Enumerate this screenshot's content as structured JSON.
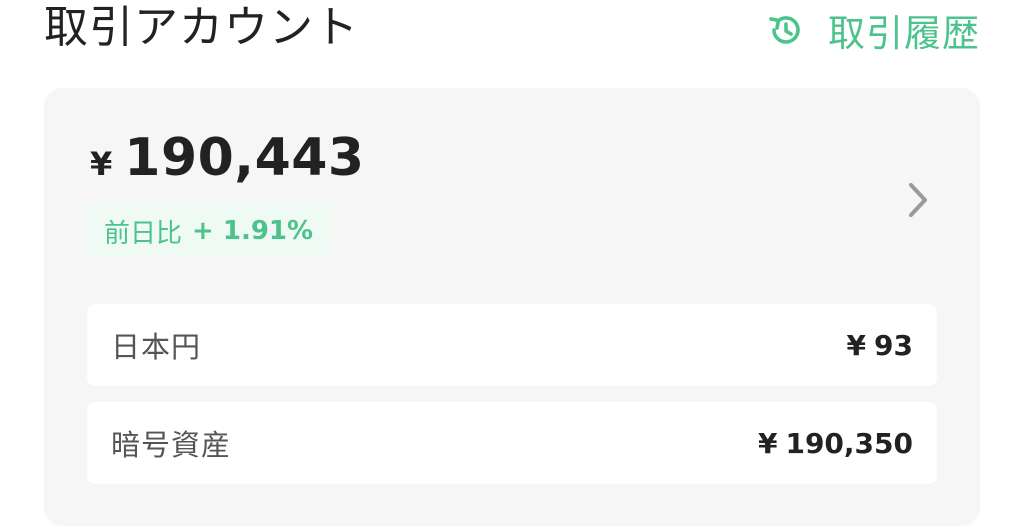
{
  "header": {
    "title": "取引アカウント",
    "history_link": {
      "label": "取引履歴",
      "icon": "history-icon"
    }
  },
  "account": {
    "currency_symbol": "¥",
    "total": "190,443",
    "change_label": "前日比",
    "change_value": "+ 1.91%",
    "chevron_icon": "chevron-right-icon",
    "assets": [
      {
        "label": "日本円",
        "currency_symbol": "¥",
        "value": "93"
      },
      {
        "label": "暗号資産",
        "currency_symbol": "¥",
        "value": "190,350"
      }
    ]
  },
  "colors": {
    "accent": "#4cc38a",
    "card_background": "#f6f6f6",
    "badge_background": "#eefaf3",
    "text_primary": "#222222",
    "text_secondary": "#555555",
    "chevron": "#9a9a9a"
  }
}
